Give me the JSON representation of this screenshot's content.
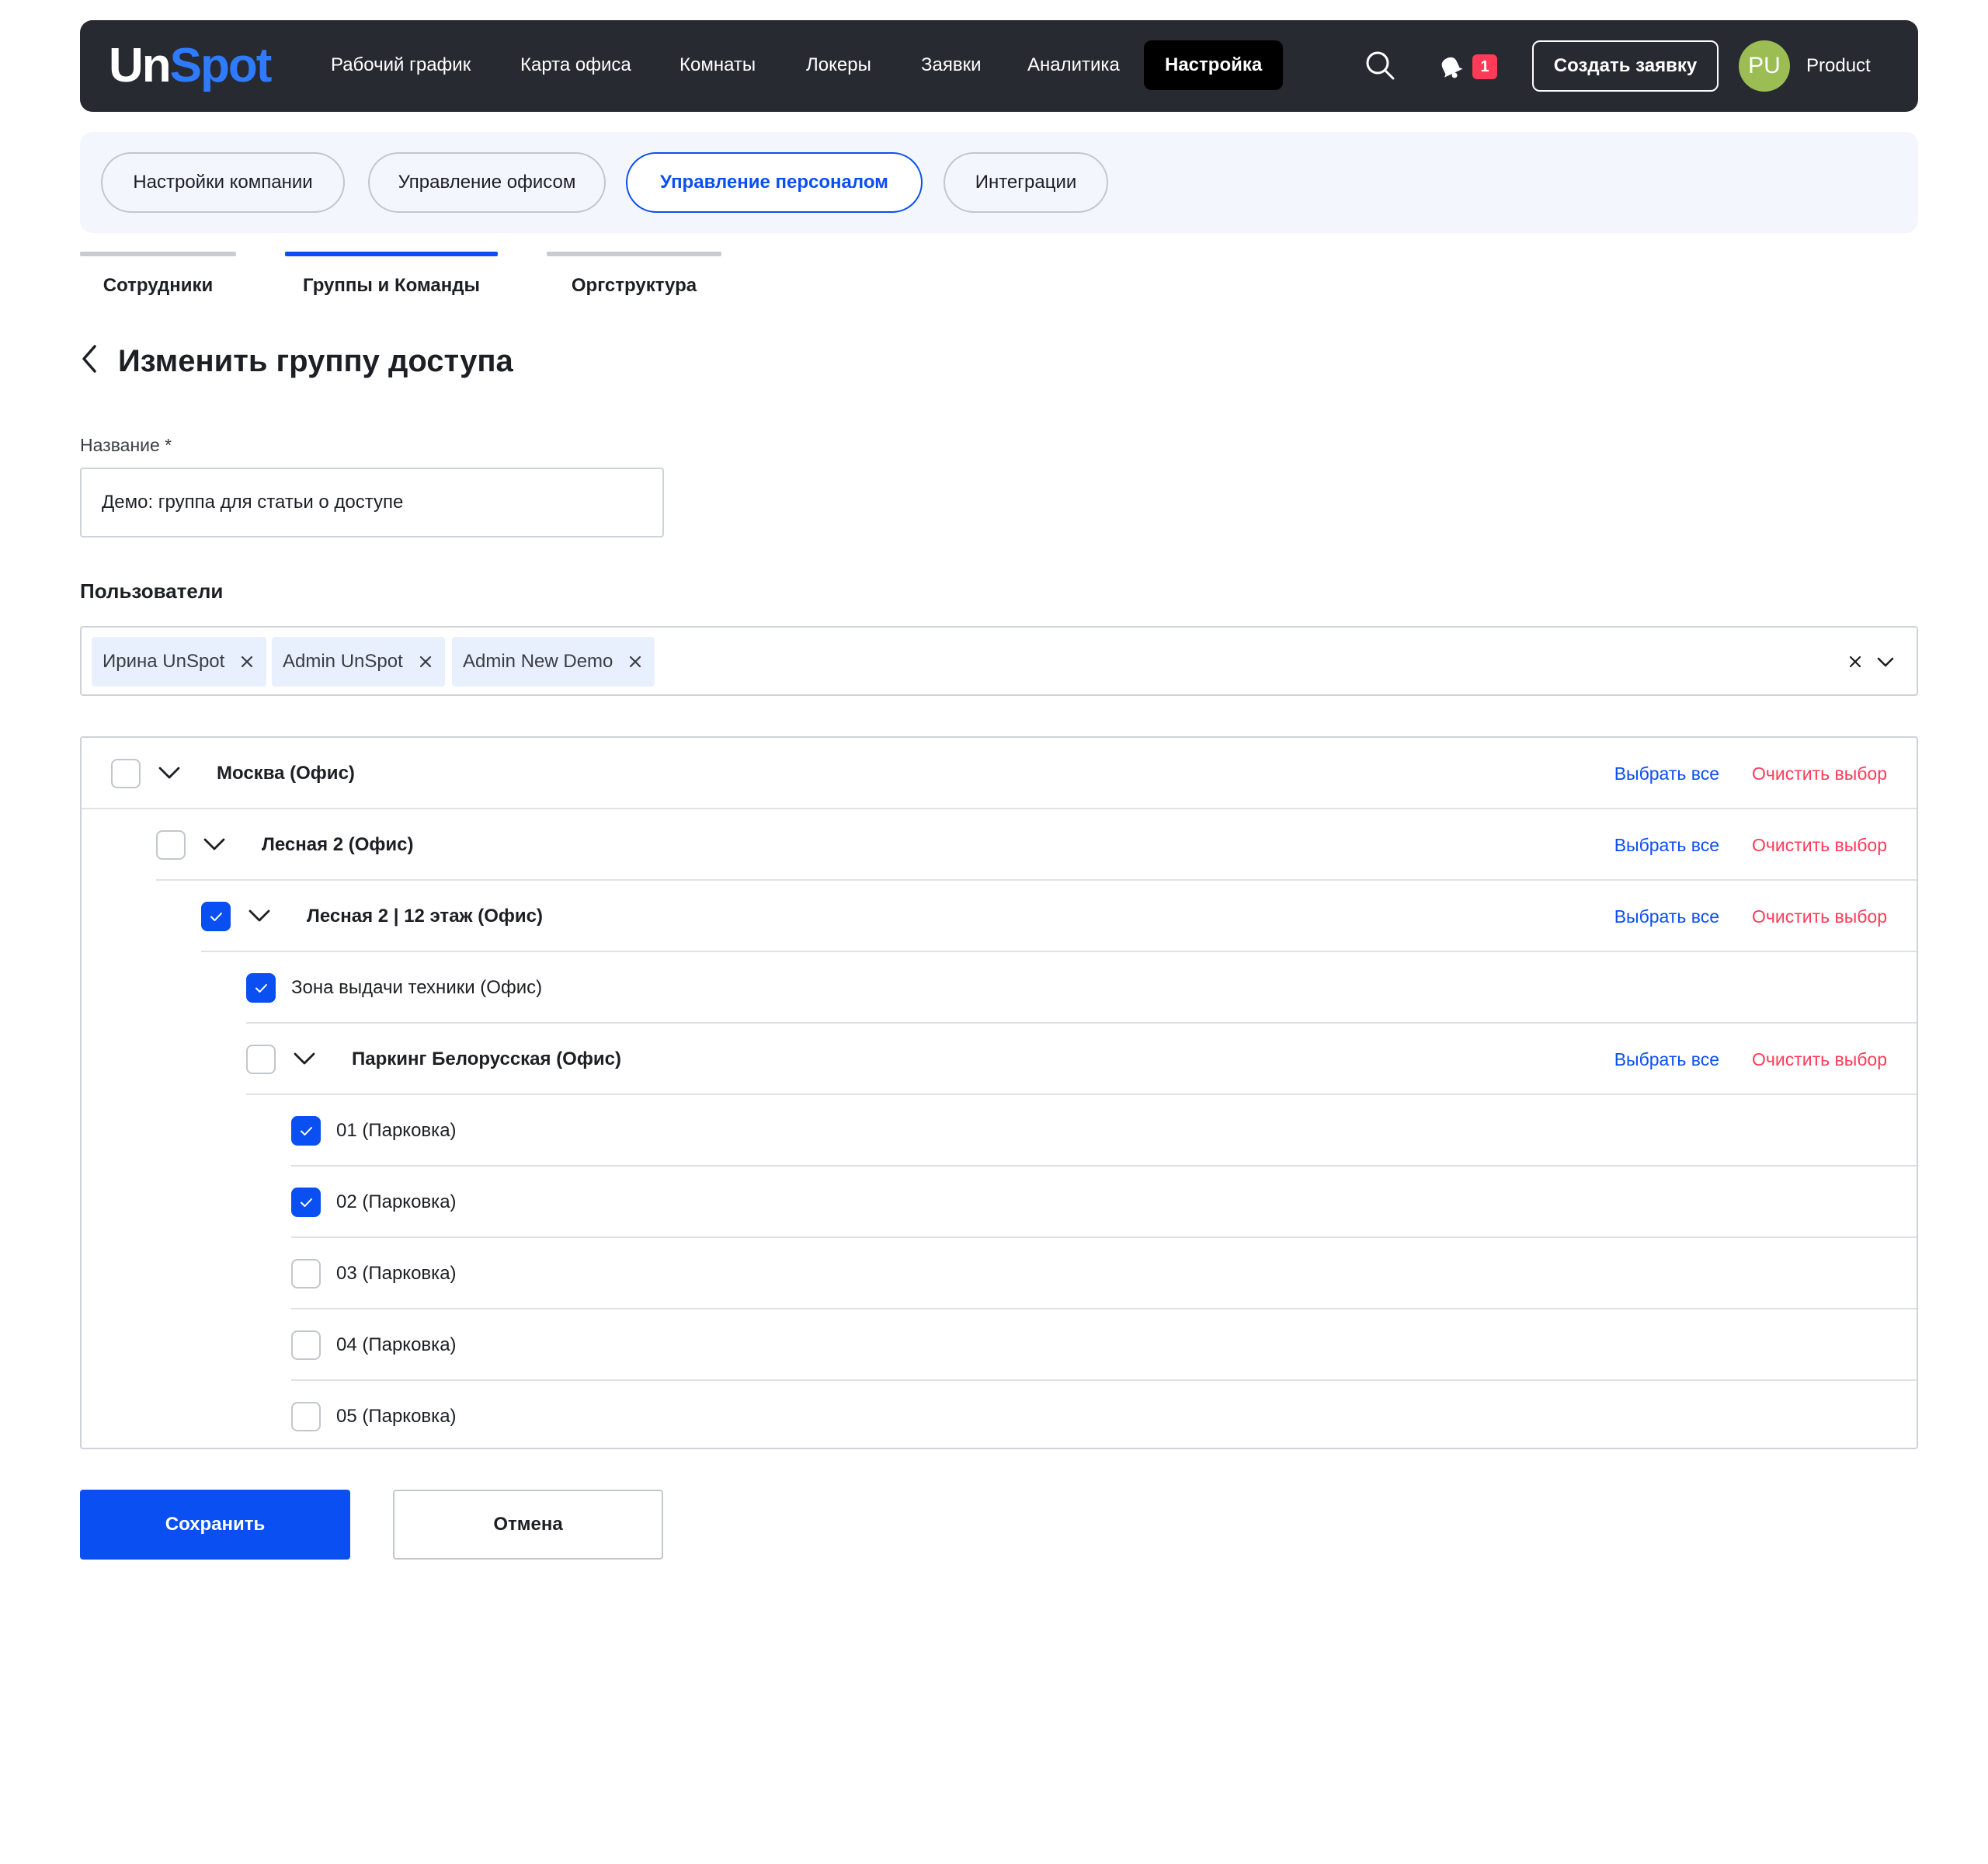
{
  "header": {
    "logo_un": "Un",
    "logo_spot": "Spot",
    "nav": [
      {
        "label": "Рабочий график"
      },
      {
        "label": "Карта офиса"
      },
      {
        "label": "Комнаты"
      },
      {
        "label": "Локеры"
      },
      {
        "label": "Заявки"
      },
      {
        "label": "Аналитика"
      },
      {
        "label": "Настройка",
        "active": true
      }
    ],
    "notification_count": "1",
    "create_button": "Создать заявку",
    "avatar_initials": "PU",
    "user_name": "Product"
  },
  "sections": [
    {
      "label": "Настройки компании"
    },
    {
      "label": "Управление офисом"
    },
    {
      "label": "Управление персоналом",
      "active": true
    },
    {
      "label": "Интеграции"
    }
  ],
  "subtabs": [
    {
      "label": "Сотрудники"
    },
    {
      "label": "Группы и Команды",
      "active": true
    },
    {
      "label": "Оргструктура"
    }
  ],
  "page": {
    "title": "Изменить группу доступа"
  },
  "form": {
    "name_label": "Название *",
    "name_value": "Демо: группа для статьи о доступе",
    "users_label": "Пользователи",
    "users": [
      {
        "name": "Ирина UnSpot"
      },
      {
        "name": "Admin UnSpot"
      },
      {
        "name": "Admin New Demo"
      }
    ]
  },
  "tree": {
    "select_all_label": "Выбрать все",
    "clear_label": "Очистить выбор",
    "rows": [
      {
        "label": "Москва (Офис)",
        "checked": false,
        "expandable": true
      },
      {
        "label": "Лесная 2 (Офис)",
        "checked": false,
        "expandable": true
      },
      {
        "label": "Лесная 2 | 12 этаж (Офис)",
        "checked": true,
        "expandable": true
      },
      {
        "label": "Зона выдачи техники (Офис)",
        "checked": true,
        "expandable": false
      },
      {
        "label": "Паркинг Белорусская (Офис)",
        "checked": false,
        "expandable": true
      },
      {
        "label": "01 (Парковка)",
        "checked": true,
        "expandable": false
      },
      {
        "label": "02 (Парковка)",
        "checked": true,
        "expandable": false
      },
      {
        "label": "03 (Парковка)",
        "checked": false,
        "expandable": false
      },
      {
        "label": "04 (Парковка)",
        "checked": false,
        "expandable": false
      },
      {
        "label": "05 (Парковка)",
        "checked": false,
        "expandable": false
      }
    ]
  },
  "actions": {
    "save": "Сохранить",
    "cancel": "Отмена"
  },
  "colors": {
    "primary": "#0a4ff2",
    "danger": "#ff3b57",
    "header_bg": "#272a30",
    "avatar_bg": "#9bbd54"
  }
}
